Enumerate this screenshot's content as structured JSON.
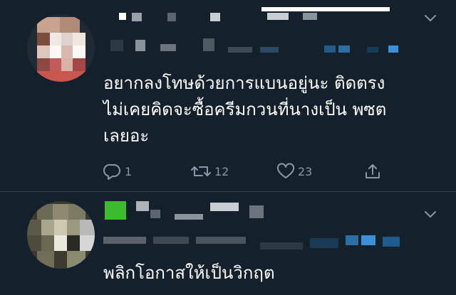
{
  "tweets": [
    {
      "text_lines": [
        "อยากลงโทษด้วยการแบนอยู่นะ ติดตรง",
        "ไม่เคยคิดจะซื้อครีมกวนที่นางเป็น พซต",
        "เลยอะ"
      ],
      "actions": {
        "reply_count": "1",
        "retweet_count": "12",
        "like_count": "23"
      },
      "menu_icon": "chevron-down-icon",
      "avatar_icon": "pixelated-avatar"
    },
    {
      "text_lines": [
        "พลิกโอกาสให้เป็นวิกฤต"
      ],
      "menu_icon": "chevron-down-icon",
      "avatar_icon": "pixelated-avatar"
    }
  ],
  "icons": {
    "reply": "reply-icon",
    "retweet": "retweet-icon",
    "like": "heart-icon",
    "share": "share-icon"
  },
  "colors": {
    "background": "#14202b",
    "divider": "#38444d",
    "muted": "#8899a6",
    "text": "#ffffff"
  }
}
